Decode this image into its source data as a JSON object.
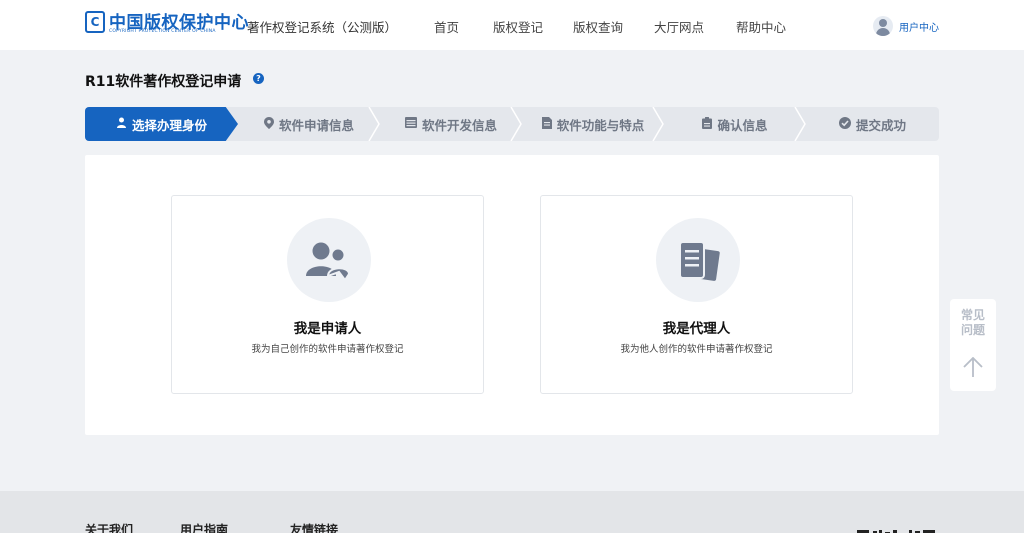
{
  "header": {
    "logo_badge": "C",
    "logo_cn": "中国版权保护中心",
    "logo_en": "COPYRIGHT PROTECTION CENTER OF CHINA",
    "system_name": "著作权登记系统（公测版）",
    "nav": [
      "首页",
      "版权登记",
      "版权查询",
      "大厅网点",
      "帮助中心"
    ],
    "user_label": "用户中心"
  },
  "page": {
    "title": "R11软件著作权登记申请",
    "help_glyph": "?"
  },
  "steps": [
    {
      "label": "选择办理身份",
      "icon": "user-icon",
      "active": true
    },
    {
      "label": "软件申请信息",
      "icon": "location-pin-icon",
      "active": false
    },
    {
      "label": "软件开发信息",
      "icon": "calendar-icon",
      "active": false
    },
    {
      "label": "软件功能与特点",
      "icon": "document-icon",
      "active": false
    },
    {
      "label": "确认信息",
      "icon": "clipboard-icon",
      "active": false
    },
    {
      "label": "提交成功",
      "icon": "check-circle-icon",
      "active": false
    }
  ],
  "cards": [
    {
      "title": "我是申请人",
      "desc": "我为自己创作的软件申请著作权登记",
      "icon": "users-icon"
    },
    {
      "title": "我是代理人",
      "desc": "我为他人创作的软件申请著作权登记",
      "icon": "document-stack-icon"
    }
  ],
  "faq": {
    "label_line1": "常见",
    "label_line2": "问题"
  },
  "footer": {
    "links": [
      "关于我们",
      "用户指南",
      "友情链接"
    ]
  },
  "colors": {
    "primary": "#1664c0",
    "step_bg": "#e4e7ec",
    "page_bg": "#f0f2f5"
  }
}
